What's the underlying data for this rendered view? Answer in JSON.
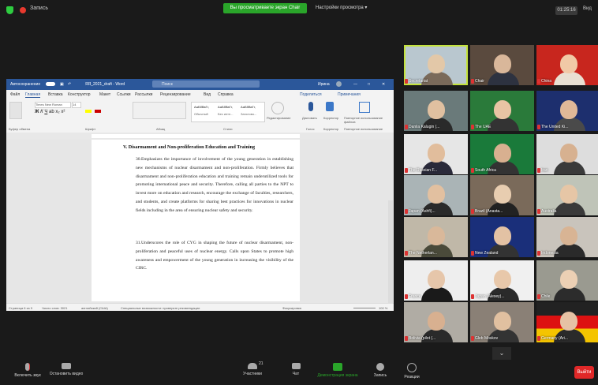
{
  "topbar": {
    "rec_label": "Запись",
    "share_banner": "Вы просматриваете экран Chair",
    "view_options": "Настройки просмотра ▾",
    "clock": "01:25:16",
    "view_toggle": "Вид"
  },
  "word": {
    "autosave": "Автосохранение",
    "doc_title": "ЯЯ_2021_draft - Word",
    "search_placeholder": "Поиск",
    "user": "Ирина",
    "tabs": [
      "Файл",
      "Главная",
      "Вставка",
      "Конструктор",
      "Макет",
      "Ссылки",
      "Рассылки",
      "Рецензирование",
      "Вид",
      "Справка"
    ],
    "share_btn": "Поделиться",
    "notes_btn": "Примечания",
    "font_name": "Times New Roman",
    "font_size": "14",
    "styles": [
      "АаБбВвГг,",
      "АаБбВвГг,",
      "АаБбВвГг,"
    ],
    "style_names": [
      "Обычный",
      "Без инте...",
      "Заголово..."
    ],
    "editing": "Редактирование",
    "dictation": "Диктовать",
    "editor": "Корректор",
    "reuse": "Повторное использование файлов",
    "group_labels": [
      "Буфер обмена",
      "Шрифт",
      "Абзац",
      "Стили",
      "Голос",
      "Корректор",
      "Повторное использование"
    ],
    "heading": "V. Disarmament and Non-proliferation Education and Training",
    "para30": "30.Emphasizes the importance of involvement of the young generation in establishing new mechanisms of nuclear disarmament and non-proliferation. Firmly believes that disarmament and non-proliferation education and training remain underutilized tools for promoting international peace and security. Therefore, calling all parties to the NPT to invest more on education and research, encourage the exchange of faculties, researchers, and students, and create platforms for sharing best practices for innovations in nuclear fields including in the area of ensuring nuclear safety and security.",
    "para31": "31.Underscores the role of CYG in shaping the future of nuclear disarmament, non-proliferation and peaceful uses of nuclear energy. Calls upon States to promote high awareness and empowerment of the young generation in increasing the visibility of the CIRC.",
    "status_page": "Страница 6 из 9",
    "status_words": "Число слов: 3021",
    "status_lang": "английский (США)",
    "status_access": "Специальные возможности: проверьте рекомендации",
    "status_focus": "Фокусировка",
    "zoom": "100 %"
  },
  "gallery": [
    {
      "name": "Secretariat",
      "active": true
    },
    {
      "name": "Chair"
    },
    {
      "name": "China"
    },
    {
      "name": "Danila Kalugin (..."
    },
    {
      "name": "The UAE"
    },
    {
      "name": "The United Ki..."
    },
    {
      "name": "The Russian F..."
    },
    {
      "name": "South Africa"
    },
    {
      "name": "Iran"
    },
    {
      "name": "Japan (Ashfi)..."
    },
    {
      "name": "Brazil (Anasta..."
    },
    {
      "name": "Australia"
    },
    {
      "name": "The Netherlan..."
    },
    {
      "name": "New Zealand"
    },
    {
      "name": "Indonesia"
    },
    {
      "name": "France"
    },
    {
      "name": "Japan (Alexey)..."
    },
    {
      "name": "Chile"
    },
    {
      "name": "Bolivia (pilot (..."
    },
    {
      "name": "Gleb Moskov"
    },
    {
      "name": "Germany (Ari..."
    }
  ],
  "toolbar": {
    "mute": "Включить звук",
    "video": "Остановить видео",
    "participants": "Участники",
    "participants_count": "21",
    "chat": "Чат",
    "share": "Демонстрация экрана",
    "record": "Запись",
    "reactions": "Реакции",
    "leave": "Выйти"
  },
  "colors": {
    "share_green": "#2aa52a",
    "word_blue": "#2b579a",
    "active_speaker": "#c4e23b",
    "leave_red": "#e02828"
  }
}
